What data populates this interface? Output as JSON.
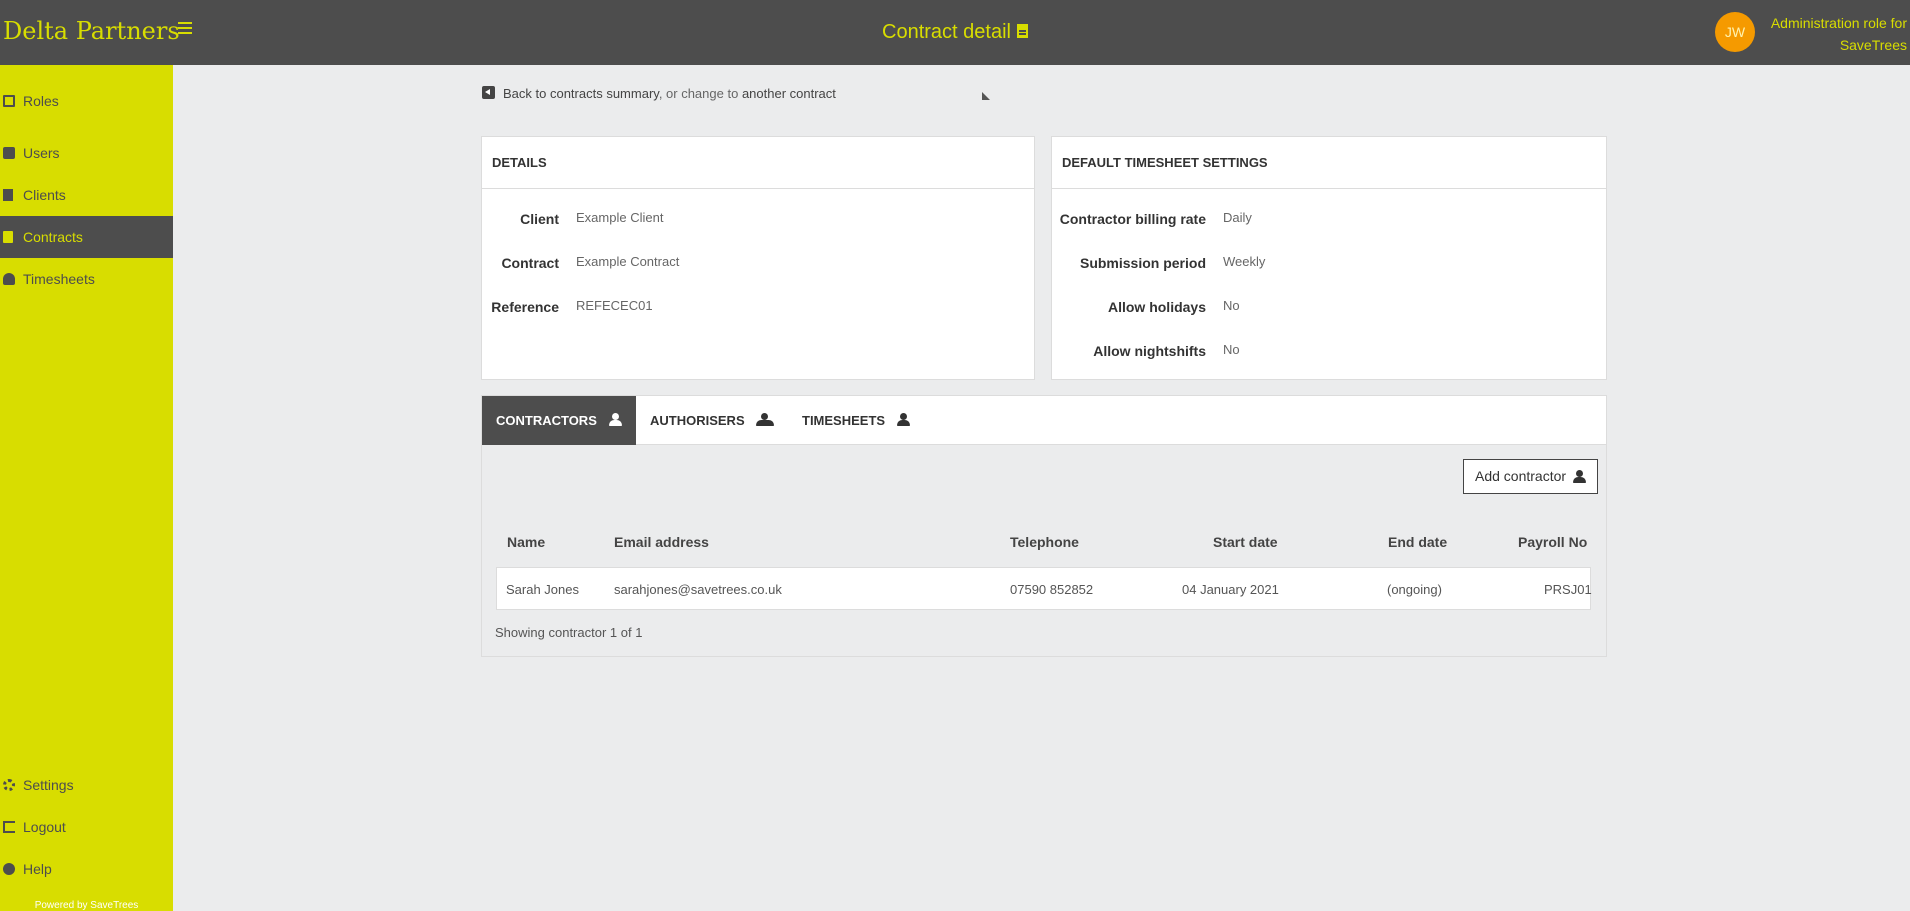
{
  "app": {
    "brand": "Delta Partners",
    "page_title": "Contract detail",
    "avatar_initials": "JW",
    "role_line1": "Administration role for",
    "role_line2": "SaveTrees"
  },
  "sidebar": {
    "items": [
      {
        "label": "Roles",
        "icon": "id-card-icon"
      },
      {
        "label": "Users",
        "icon": "address-book-icon"
      },
      {
        "label": "Clients",
        "icon": "building-icon"
      },
      {
        "label": "Contracts",
        "icon": "document-icon"
      },
      {
        "label": "Timesheets",
        "icon": "user-clock-icon"
      }
    ],
    "bottom_items": [
      {
        "label": "Settings",
        "icon": "gear-icon"
      },
      {
        "label": "Logout",
        "icon": "sign-out-icon"
      },
      {
        "label": "Help",
        "icon": "question-circle-icon"
      }
    ],
    "powered_by": "Powered by SaveTrees"
  },
  "breadcrumb": {
    "back_label": "Back to contracts summary",
    "separator": ", or change to",
    "other_label": "another contract"
  },
  "details": {
    "title": "DETAILS",
    "fields": [
      {
        "label": "Client",
        "value": "Example Client"
      },
      {
        "label": "Contract",
        "value": "Example Contract"
      },
      {
        "label": "Reference",
        "value": "REFECEC01"
      }
    ]
  },
  "timesheet_settings": {
    "title": "DEFAULT TIMESHEET SETTINGS",
    "fields": [
      {
        "label": "Contractor billing rate",
        "value": "Daily"
      },
      {
        "label": "Submission period",
        "value": "Weekly"
      },
      {
        "label": "Allow holidays",
        "value": "No"
      },
      {
        "label": "Allow nightshifts",
        "value": "No"
      }
    ]
  },
  "tabs": [
    {
      "label": "CONTRACTORS",
      "active": true
    },
    {
      "label": "AUTHORISERS",
      "active": false
    },
    {
      "label": "TIMESHEETS",
      "active": false
    }
  ],
  "contractors": {
    "add_button": "Add contractor",
    "columns": [
      "Name",
      "Email address",
      "Telephone",
      "Start date",
      "End date",
      "Payroll No"
    ],
    "rows": [
      {
        "name": "Sarah Jones",
        "email": "sarahjones@savetrees.co.uk",
        "telephone": "07590 852852",
        "start": "04 January 2021",
        "end": "(ongoing)",
        "payroll": "PRSJ01"
      }
    ],
    "count_text": "Showing contractor 1 of 1"
  },
  "colors": {
    "accent": "#d8dd00",
    "dark": "#4d4d4d",
    "avatar": "#f59a00"
  }
}
